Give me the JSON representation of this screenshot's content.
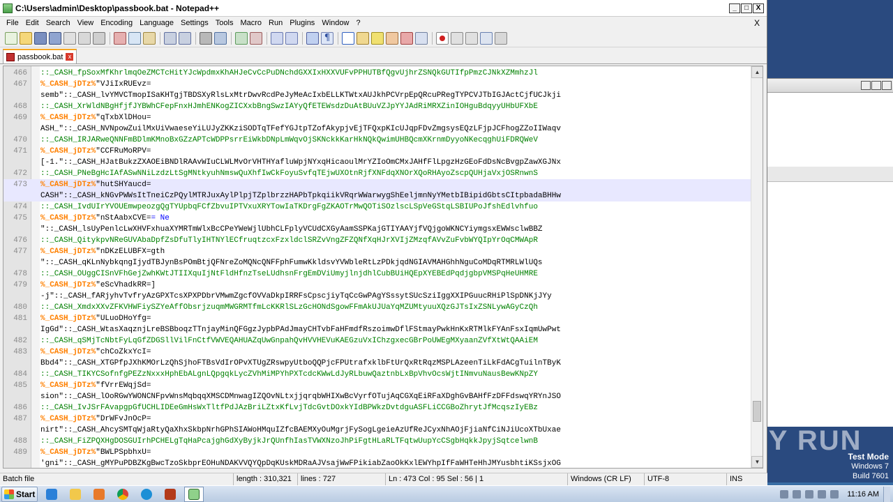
{
  "window": {
    "title": "C:\\Users\\admin\\Desktop\\passbook.bat - Notepad++",
    "btn_min": "_",
    "btn_max": "□",
    "btn_close": "X"
  },
  "menu": {
    "items": [
      "File",
      "Edit",
      "Search",
      "View",
      "Encoding",
      "Language",
      "Settings",
      "Tools",
      "Macro",
      "Run",
      "Plugins",
      "Window",
      "?"
    ],
    "close": "X"
  },
  "tab": {
    "label": "passbook.bat",
    "close": "x"
  },
  "editor": {
    "lines": [
      {
        "num": "466",
        "segments": [
          {
            "t": "::_CASH_fpSoxMfKhrlmqOeZMCTcHitYJcWpdmxKhAHJeCvCcPuDNchdGXXIxHXXVUFvPPHUTBfQgvUjhrZSNQkGUTIfpPmzCJNkXZMmhzJl",
            "c": "comment"
          }
        ]
      },
      {
        "num": "467",
        "segments": [
          {
            "t": "%_CASH_jDTz%",
            "c": "var"
          },
          {
            "t": "\"VJiIxRUEvz=",
            "c": "text"
          }
        ]
      },
      {
        "num": "",
        "segments": [
          {
            "t": "semb\"::_CASH_lvYMVCTmopISaKHTgjTBDSXyRlsLxMtrDwvRcdPeJyMeAcIxbELLKTWtxAUJkhPCVrpEpQRcuPRegTYPCVJTbIGJActCjfUCJkji",
            "c": "text"
          }
        ]
      },
      {
        "num": "468",
        "segments": [
          {
            "t": "::_CASH_XrWldNBgHfjfJYBWhCFepFnxHJmhENKogZICXxbBngSwzIAYyQfETEWsdzDuAtBUuVZJpYYJAdRiMRXZinIOHguBdqyyUHbUFXbE",
            "c": "comment"
          }
        ]
      },
      {
        "num": "469",
        "segments": [
          {
            "t": "%_CASH_jDTz%",
            "c": "var"
          },
          {
            "t": "\"qTxbXlDHou=",
            "c": "text"
          }
        ]
      },
      {
        "num": "",
        "segments": [
          {
            "t": "ASH_\"::_CASH_NVNpowZuilMxUiVwaeseYiLUJyZKKziSODTqTFefYGJtpTZofAkypjvEjTFQxpKIcUJqpFDvZmgsysEQzLFjpJCFhogZZoIIWaqv",
            "c": "text"
          }
        ]
      },
      {
        "num": "470",
        "segments": [
          {
            "t": "::_CASH_IRJARweQNNFmBDlmKMnoBxGZzAPTcWDPPsrrEiWkbDNpLmWqvOjSKNckkKarHkNQkQwimUHBQcmXKrnmDyyoNKecqghUiFDRQWeV",
            "c": "comment"
          }
        ]
      },
      {
        "num": "471",
        "segments": [
          {
            "t": "%_CASH_jDTz%",
            "c": "var"
          },
          {
            "t": "\"CCFRuMoRPV=",
            "c": "text"
          }
        ]
      },
      {
        "num": "",
        "segments": [
          {
            "t": "[-1.\"::_CASH_HJatBukzZXAOEiBNDlRAAvWIuCLWLMvOrVHTHYafluWpjNYxqHicaoulMrYZIoOmCMxJAHfFlLpgzHzGEoFdDsNcBvgpZawXGJNx",
            "c": "text"
          }
        ]
      },
      {
        "num": "472",
        "segments": [
          {
            "t": "::_CASH_PNeBgHcIAfASwNNiLzdzLtSgMNtkyuhNmswQuXhfIwCkFoyuSvfqTEjwUXOtnRjfXNFdqXNOrXQoRHAyoZscpQUHjaVxjOSRnwnS",
            "c": "comment"
          }
        ]
      },
      {
        "num": "473",
        "segments": [
          {
            "t": "%_CASH_jDTz%",
            "c": "var"
          },
          {
            "t": "\"hutSHYaucd=",
            "c": "text"
          }
        ],
        "active": true
      },
      {
        "num": "",
        "segments": [
          {
            "t": "CASH\"::_CASH_kNGvPWWsItTneiCzPQylMTRJuxAylPlpjTZplbrzzHAPbTpkqiikVRqrWWarwygShEeljmnNyYMetbIBipidGbtsCItpbadaBHHw",
            "c": "text"
          }
        ],
        "active": true
      },
      {
        "num": "474",
        "segments": [
          {
            "t": "::_CASH_IvdUIrYVOUEmwpeozgQgTYUpbqFCfZbvuIPTVxuXRYTowIaTKDrgFgZKAOTrMwQOTiSOzlscLSpVeGStqLSBIUPoJfshEdlvhfuo",
            "c": "comment"
          }
        ]
      },
      {
        "num": "475",
        "segments": [
          {
            "t": "%_CASH_jDTz%",
            "c": "var"
          },
          {
            "t": "\"nStAabxCVE=",
            "c": "text"
          },
          {
            "t": "= Ne",
            "c": "blue"
          }
        ]
      },
      {
        "num": "",
        "segments": [
          {
            "t": "\"::_CASH_lsUyPenlcLwXHVFxhuaXYMRTmWlxBcCPeYWeWjlUbhCLFplyVCUdCXGyAamSSPKajGTIYAAYjfVQjgoWKNCYiymgsxEWWsclwBBZ",
            "c": "text"
          }
        ]
      },
      {
        "num": "476",
        "segments": [
          {
            "t": "::_CASH_QitykpvNReGUVAbaDpfZsDfuTlyIHTNYlECfruqtzcxFzxldclSRZvVngZFZQNfXqHJrXVIjZMzqfAVvZuFvbWYQIpYrOqCMWApR",
            "c": "comment"
          }
        ]
      },
      {
        "num": "477",
        "segments": [
          {
            "t": "%_CASH_jDTz%",
            "c": "var"
          },
          {
            "t": "\"nDKzELUBFX=gth",
            "c": "text"
          }
        ]
      },
      {
        "num": "",
        "segments": [
          {
            "t": "\"::_CASH_qKLnNybkqngIjydTBJynBsPOmBtjQFNreZoMQNcQNFFphFumwKkldsvYVWbleRtLzPDkjqdNGIAVMAHGhhNguCoMDqRTMRLWlUQs",
            "c": "text"
          }
        ]
      },
      {
        "num": "478",
        "segments": [
          {
            "t": "::_CASH_OUggCISnVFhGejZwhKWtJTIIXquIjNtFldHfnzTseLUdhsnFrgEmDViUmyjlnjdhlCubBUiHQEpXYEBEdPqdjgbpVMSPqHeUHMRE",
            "c": "comment"
          }
        ]
      },
      {
        "num": "479",
        "segments": [
          {
            "t": "%_CASH_jDTz%",
            "c": "var"
          },
          {
            "t": "\"eScVhadkRR=]",
            "c": "text"
          }
        ]
      },
      {
        "num": "",
        "segments": [
          {
            "t": "-j\"::_CASH_fARjyhvTvfryAzGPXTcsXPXPDbrVMwmZgcfOVVaDkpIRRFsCpscjiyTqCcGwPAgYSssytSUcSziIggXXIPGuucRHiPlSpDNKjJYy",
            "c": "text"
          }
        ]
      },
      {
        "num": "480",
        "segments": [
          {
            "t": "::_CASH_XmdxXXvZFKVHWFiySZYeAffObsrjzuqmMWGRMTfmLcKKRlSLzGcHONdSgowFFmAkUJUaYqMZUMtyuuXQzGJTsIxZSNLywAGyCzQh",
            "c": "comment"
          }
        ]
      },
      {
        "num": "481",
        "segments": [
          {
            "t": "%_CASH_jDTz%",
            "c": "var"
          },
          {
            "t": "\"ULuoDHoYfg=",
            "c": "text"
          }
        ]
      },
      {
        "num": "",
        "segments": [
          {
            "t": "IgGd\"::_CASH_WtasXaqznjLreBSBboqzTTnjayMinQFGgzJypbPAdJmayCHTvbFaHFmdfRszoimwDflFStmayPwkHnKxRTMlkFYAnFsxIqmUwPwt",
            "c": "text"
          }
        ]
      },
      {
        "num": "482",
        "segments": [
          {
            "t": "::_CASH_qSMjTcNbtFyLqGfZDGSllVilFnCtfVWVEQAHUAZqUwGnpahQvHVVHEVuKAEGzuVxIChzgxecGBrPoUWEgMXyaanZVfXtWtQAAiEM",
            "c": "comment"
          }
        ]
      },
      {
        "num": "483",
        "segments": [
          {
            "t": "%_CASH_jDTz%",
            "c": "var"
          },
          {
            "t": "\"chCoZkxYcI=",
            "c": "text"
          }
        ]
      },
      {
        "num": "",
        "segments": [
          {
            "t": "Bbd4\"::_CASH_XTGPfpJXhKMOrLzQhSjhoFTBsVdIrOPvXTUgZRswpyUtboQQPjcFPUtrafxklbFtUrQxRtRqzMSPLAzeenTiLkFdACgTuilnTByK",
            "c": "text"
          }
        ]
      },
      {
        "num": "484",
        "segments": [
          {
            "t": "::_CASH_TIKYCSofnfgPEZzNxxxHphEbALgnLQpgqkLycZVhMiMPYhPXTcdcKWwLdJyRLbuwQaztnbLxBpVhvOcsWjtINmvuNausBewKNpZY",
            "c": "comment"
          }
        ]
      },
      {
        "num": "485",
        "segments": [
          {
            "t": "%_CASH_jDTz%",
            "c": "var"
          },
          {
            "t": "\"fVrrEWqjSd=",
            "c": "text"
          }
        ]
      },
      {
        "num": "",
        "segments": [
          {
            "t": "sion\"::_CASH_lOoRGwYWONCNFpvWnsMqbqqXMSCDMnwagIZQOvNLtxjjqrqbWHIXwBcVyrfOTujAqCGXqEiRFaXDghGvBAHfFzDFFdswqYRYnJSO",
            "c": "text"
          }
        ]
      },
      {
        "num": "486",
        "segments": [
          {
            "t": "::_CASH_IvJSrFAvapgpGfUCHLIDEeGmHsWxTltfPdJAzBriLZtxKfLvjTdcGvtDOxkYIdBPWkzDvtdguASFLiCCGBoZhrytJfMcqszIyEBz",
            "c": "comment"
          }
        ]
      },
      {
        "num": "487",
        "segments": [
          {
            "t": "%_CASH_jDTz%",
            "c": "var"
          },
          {
            "t": "\"DrWFvJnOcP=",
            "c": "text"
          }
        ]
      },
      {
        "num": "",
        "segments": [
          {
            "t": "nirt\"::_CASH_AhcySMTqWjaRtyQaXhxSkbpNrhGPhSIAWoHMquIZfcBAEMXyOuMgrjFySogLgeieAzUfReJCyxNhAOjFjiaNfCiNJiUcoXTbUxae",
            "c": "text"
          }
        ]
      },
      {
        "num": "488",
        "segments": [
          {
            "t": "::_CASH_FiZPQXHgDOSGUIrhPCHELgTqHaPcajghGdXyByjkJrQUnfhIasTVWXNzoJhPiFgtHLaRLTFqtwUupYcCSgbHqkkJpyjSqtcelwnB",
            "c": "comment"
          }
        ]
      },
      {
        "num": "489",
        "segments": [
          {
            "t": "%_CASH_jDTz%",
            "c": "var"
          },
          {
            "t": "\"BWLPSpbhxU=",
            "c": "text"
          }
        ]
      },
      {
        "num": "",
        "segments": [
          {
            "t": "'gni\"::_CASH_gMYPuPDBZKgBwcTzoSkbprEOHuNDAKVVQYQpDqKUskMDRaAJVsajWwFPikiabZaoOkKxlEWYhpIfFaWHTeHhJMYusbhtiKSsjxOG",
            "c": "text"
          }
        ]
      }
    ]
  },
  "statusbar": {
    "type": "Batch file",
    "length": "length : 310,321",
    "lines": "lines : 727",
    "pos": "Ln : 473    Col : 95    Sel : 56 | 1",
    "eol": "Windows (CR LF)",
    "encoding": "UTF-8",
    "mode": "INS"
  },
  "taskbar": {
    "start": "Start",
    "clock": "11:16 AM"
  },
  "desktop": {
    "watermark": "ANY RUN",
    "testmode": "Test Mode",
    "os": "Windows 7",
    "build": "Build 7601"
  },
  "colors": {
    "comment": "#008000",
    "var": "#ff8000",
    "text": "#000000",
    "blue": "#0000ff",
    "active_line": "#e8e8ff"
  }
}
